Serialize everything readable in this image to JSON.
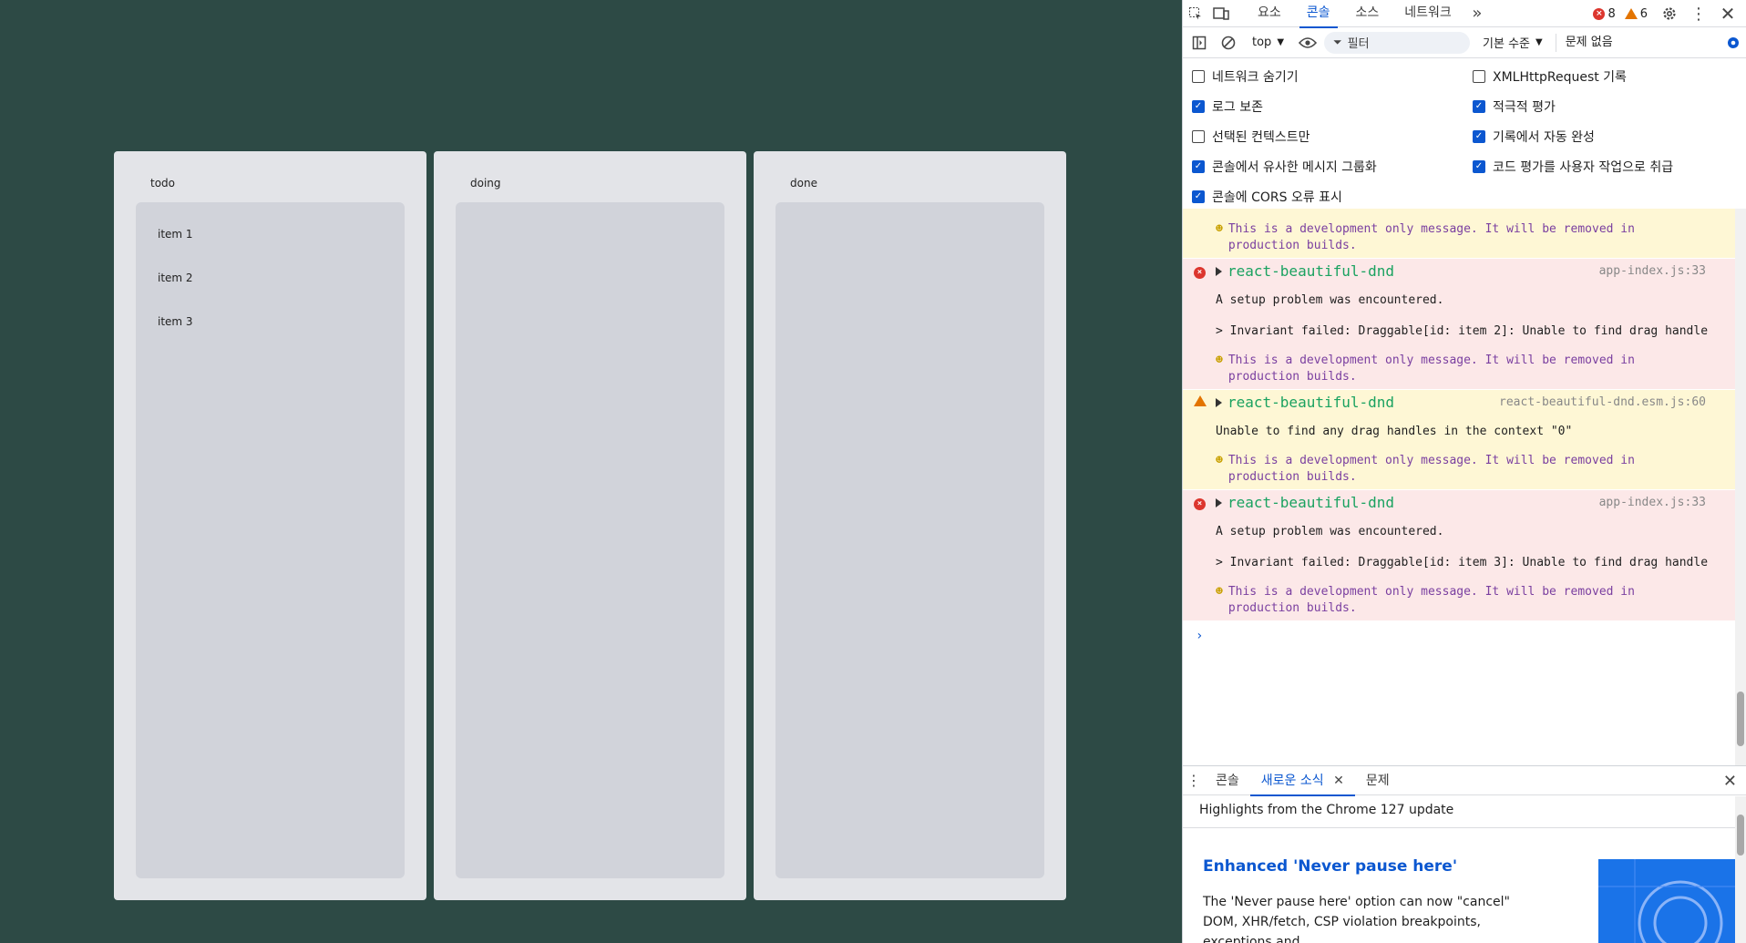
{
  "board": {
    "columns": [
      {
        "title": "todo",
        "items": [
          "item 1",
          "item 2",
          "item 3"
        ]
      },
      {
        "title": "doing",
        "items": []
      },
      {
        "title": "done",
        "items": []
      }
    ]
  },
  "devtools": {
    "tabs": [
      "요소",
      "콘솔",
      "소스",
      "네트워크"
    ],
    "active_tab": "콘솔",
    "error_count": "8",
    "warning_count": "6",
    "toolbar": {
      "context": "top",
      "filter_placeholder": "필터",
      "level": "기본 수준",
      "issues": "문제 없음"
    },
    "settings": {
      "left": [
        {
          "label": "네트워크 숨기기",
          "checked": false
        },
        {
          "label": "로그 보존",
          "checked": true
        },
        {
          "label": "선택된 컨텍스트만",
          "checked": false
        },
        {
          "label": "콘솔에서 유사한 메시지 그룹화",
          "checked": true
        },
        {
          "label": "콘솔에 CORS 오류 표시",
          "checked": true
        }
      ],
      "right": [
        {
          "label": "XMLHttpRequest 기록",
          "checked": false
        },
        {
          "label": "적극적 평가",
          "checked": true
        },
        {
          "label": "기록에서 자동 완성",
          "checked": true
        },
        {
          "label": "코드 평가를 사용자 작업으로 취급",
          "checked": true
        }
      ]
    },
    "console": {
      "top_note": "This is a development only message. It will be removed in production builds.",
      "messages": [
        {
          "level": "error",
          "package": "react-beautiful-dnd",
          "source": "app-index.js:33",
          "lines": [
            "A setup problem was encountered.",
            "> Invariant failed: Draggable[id: item 2]: Unable to find drag handle"
          ],
          "note": "This is a development only message. It will be removed in production builds."
        },
        {
          "level": "warn",
          "package": "react-beautiful-dnd",
          "source": "react-beautiful-dnd.esm.js:60",
          "lines": [
            "Unable to find any drag handles in the context \"0\""
          ],
          "note": "This is a development only message. It will be removed in production builds."
        },
        {
          "level": "error",
          "package": "react-beautiful-dnd",
          "source": "app-index.js:33",
          "lines": [
            "A setup problem was encountered.",
            "> Invariant failed: Draggable[id: item 3]: Unable to find drag handle"
          ],
          "note": "This is a development only message. It will be removed in production builds."
        }
      ]
    },
    "drawer": {
      "tabs": [
        "콘솔",
        "새로운 소식",
        "문제"
      ],
      "active_tab": "새로운 소식",
      "highlight": "Highlights from the Chrome 127 update",
      "news_title": "Enhanced 'Never pause here'",
      "news_text": "The 'Never pause here' option can now \"cancel\" DOM, XHR/fetch, CSP violation breakpoints, exceptions and"
    }
  }
}
